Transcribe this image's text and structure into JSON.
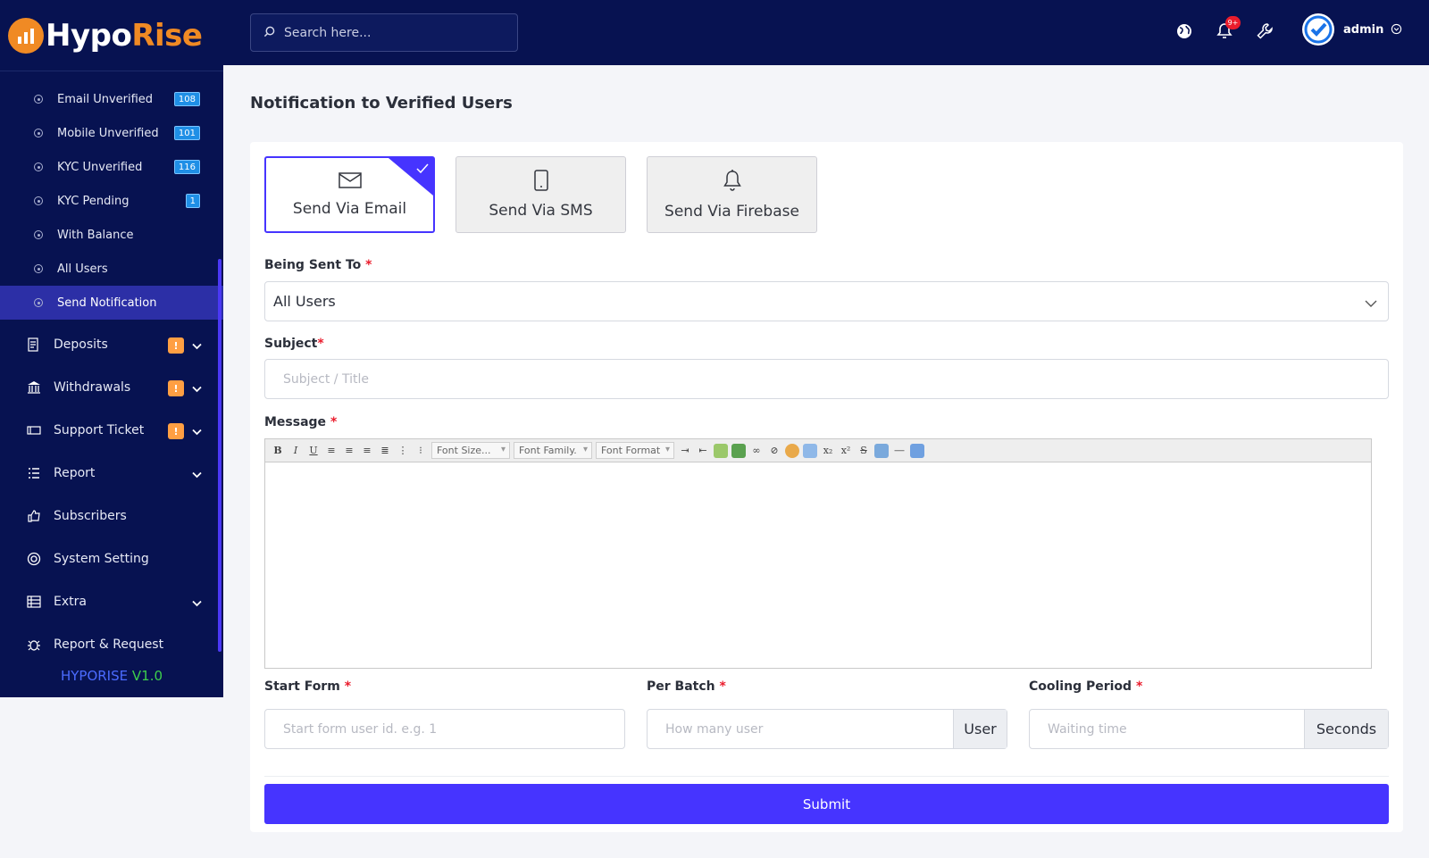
{
  "brand": {
    "part1": "Hypo",
    "part2": "Rise"
  },
  "sidebar": {
    "sub_items": [
      {
        "label": "Email Unverified",
        "badge": "108"
      },
      {
        "label": "Mobile Unverified",
        "badge": "101"
      },
      {
        "label": "KYC Unverified",
        "badge": "116"
      },
      {
        "label": "KYC Pending",
        "badge": "1"
      },
      {
        "label": "With Balance",
        "badge": ""
      },
      {
        "label": "All Users",
        "badge": ""
      },
      {
        "label": "Send Notification",
        "badge": "",
        "active": true
      }
    ],
    "items": [
      {
        "label": "Deposits",
        "warn": "!",
        "icon": "deposits-icon"
      },
      {
        "label": "Withdrawals",
        "warn": "!",
        "icon": "bank-icon"
      },
      {
        "label": "Support Ticket",
        "warn": "!",
        "icon": "ticket-icon"
      },
      {
        "label": "Report",
        "icon": "list-icon"
      },
      {
        "label": "Subscribers",
        "icon": "thumbs-up-icon"
      },
      {
        "label": "System Setting",
        "icon": "life-ring-icon"
      },
      {
        "label": "Extra",
        "icon": "server-icon"
      },
      {
        "label": "Report & Request",
        "icon": "bug-icon"
      }
    ],
    "version_name": "HYPORISE",
    "version_num": "V1.0"
  },
  "topbar": {
    "search_placeholder": "Search here...",
    "notification_count": "9+",
    "username": "admin"
  },
  "page": {
    "title": "Notification to Verified Users"
  },
  "methods": [
    {
      "label": "Send Via Email",
      "selected": true,
      "icon": "envelope-icon"
    },
    {
      "label": "Send Via SMS",
      "selected": false,
      "icon": "mobile-icon"
    },
    {
      "label": "Send Via Firebase",
      "selected": false,
      "icon": "bell-icon"
    }
  ],
  "form": {
    "being_sent_to_label": "Being Sent To",
    "being_sent_to_value": "All Users",
    "subject_label": "Subject",
    "subject_placeholder": "Subject / Title",
    "message_label": "Message",
    "editor": {
      "font_size": "Font Size...",
      "font_family": "Font Family.",
      "font_format": "Font Format"
    },
    "start_label": "Start Form",
    "start_placeholder": "Start form user id. e.g. 1",
    "batch_label": "Per Batch",
    "batch_placeholder": "How many user",
    "batch_addon": "User",
    "cooling_label": "Cooling Period",
    "cooling_placeholder": "Waiting time",
    "cooling_addon": "Seconds",
    "required_mark": "*",
    "submit": "Submit"
  },
  "colors": {
    "primary": "#4634ff",
    "sidebar": "#071251",
    "accent": "#f08a24",
    "warn": "#ff9f43"
  }
}
